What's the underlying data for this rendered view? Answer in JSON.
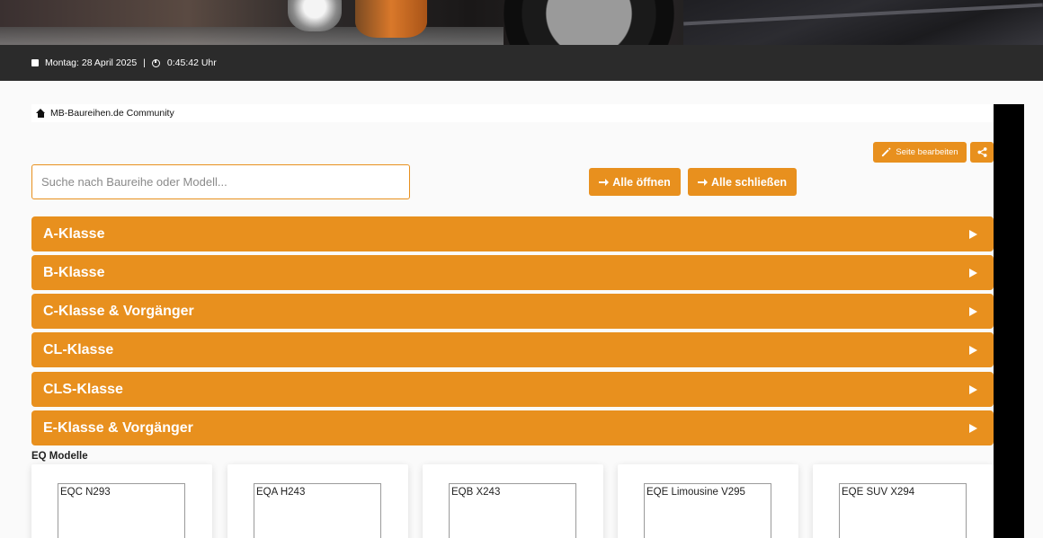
{
  "datebar": {
    "date": "Montag: 28 April 2025",
    "separator": "|",
    "time": "0:45:42 Uhr"
  },
  "breadcrumb": {
    "label": "MB-Baureihen.de Community"
  },
  "toolbar": {
    "edit_label": "Seite bearbeiten",
    "open_all_label": "Alle öffnen",
    "close_all_label": "Alle schließen"
  },
  "search": {
    "placeholder": "Suche nach Baureihe oder Modell...",
    "value": ""
  },
  "accordion": [
    {
      "label": "A-Klasse"
    },
    {
      "label": "B-Klasse"
    },
    {
      "label": "C-Klasse & Vorgänger"
    },
    {
      "label": "CL-Klasse"
    },
    {
      "label": "CLS-Klasse"
    },
    {
      "label": "E-Klasse & Vorgänger"
    }
  ],
  "eq": {
    "title": "EQ Modelle",
    "cards": [
      {
        "label": "EQC N293"
      },
      {
        "label": "EQA H243"
      },
      {
        "label": "EQB X243"
      },
      {
        "label": "EQE Limousine V295"
      },
      {
        "label": "EQE SUV X294"
      }
    ]
  },
  "colors": {
    "accent": "#e8901e",
    "datebar": "#2b2b2b"
  }
}
